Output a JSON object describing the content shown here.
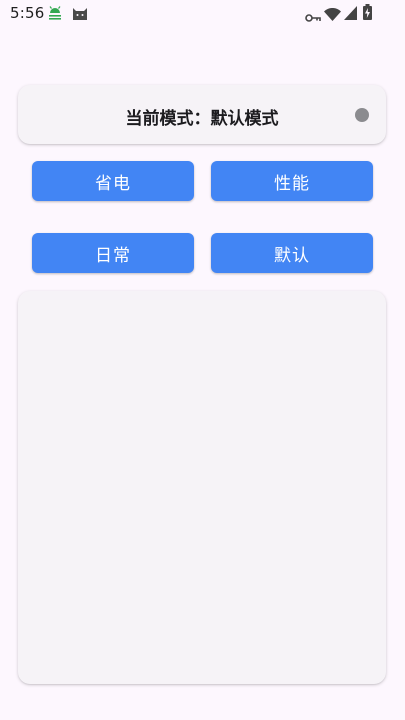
{
  "status_bar": {
    "time": "5:56",
    "notification_icons": [
      "android-debug-icon",
      "cat-app-icon"
    ],
    "system_icons": [
      "vpn-key-icon",
      "wifi-icon",
      "cellular-signal-icon",
      "battery-charging-icon"
    ]
  },
  "mode_card": {
    "title": "当前模式：默认模式",
    "indicator_color": "#8b8b8f"
  },
  "mode_buttons": [
    {
      "label": "省电"
    },
    {
      "label": "性能"
    },
    {
      "label": "日常"
    },
    {
      "label": "默认"
    }
  ],
  "colors": {
    "background": "#fdf7fe",
    "card": "#f6f3f7",
    "accent": "#4285f4"
  }
}
